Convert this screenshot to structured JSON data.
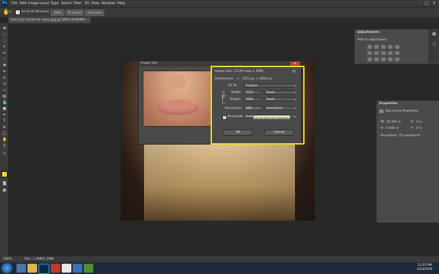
{
  "app": {
    "logo": "Ps"
  },
  "menu": [
    "File",
    "Edit",
    "Image",
    "Layer",
    "Type",
    "Select",
    "Filter",
    "3D",
    "View",
    "Window",
    "Help"
  ],
  "window_controls": {
    "minimize": "–",
    "maximize": "□",
    "close": "✕"
  },
  "options_bar": {
    "scroll_all": "Scroll All Windows",
    "zoom": "100%",
    "fit_screen": "Fit Screen",
    "fill_screen": "Fill Screen"
  },
  "tab": {
    "label": "shot-1-pc-renate-st.-moos.jpg @ 100% (RGB/8#)"
  },
  "dialog": {
    "title": "Image Size",
    "close": "✕",
    "image_size_label": "Image Size:",
    "image_size_value": "15.2M (was 1.30M)",
    "dimensions_label": "Dimensions:",
    "dimensions_value": "2553 px  ×  2083 px",
    "fit_to_label": "Fit To:",
    "fit_to_value": "Custom",
    "width_label": "Width:",
    "width_value": "2553",
    "width_unit": "Pixels",
    "height_label": "Height:",
    "height_value": "2083",
    "height_unit": "Pixels",
    "resolution_label": "Resolution:",
    "resolution_value": "150",
    "resolution_unit": "Pixels/Inch",
    "resample_label": "Resample:",
    "resample_value": "Auto",
    "tooltip": "Set the document resolution",
    "ok": "OK",
    "cancel": "Cancel"
  },
  "adjustments": {
    "title": "Adjustments",
    "subtitle": "Add an adjustment"
  },
  "properties": {
    "title": "Properties",
    "section": "Document Properties",
    "w_label": "W:",
    "w_value": "16.347 in",
    "h_label": "H:",
    "h_value": "0.444 in",
    "x_label": "X:",
    "x_value": "0 in",
    "y_label": "Y:",
    "y_value": "0 in",
    "resolution_text": "Resolution: 72 pixels/inch"
  },
  "status": {
    "zoom": "100%",
    "doc": "Doc: 1.30M/1.30M"
  },
  "taskbar": {
    "time": "12:23 PM",
    "date": "1/20/2016"
  }
}
